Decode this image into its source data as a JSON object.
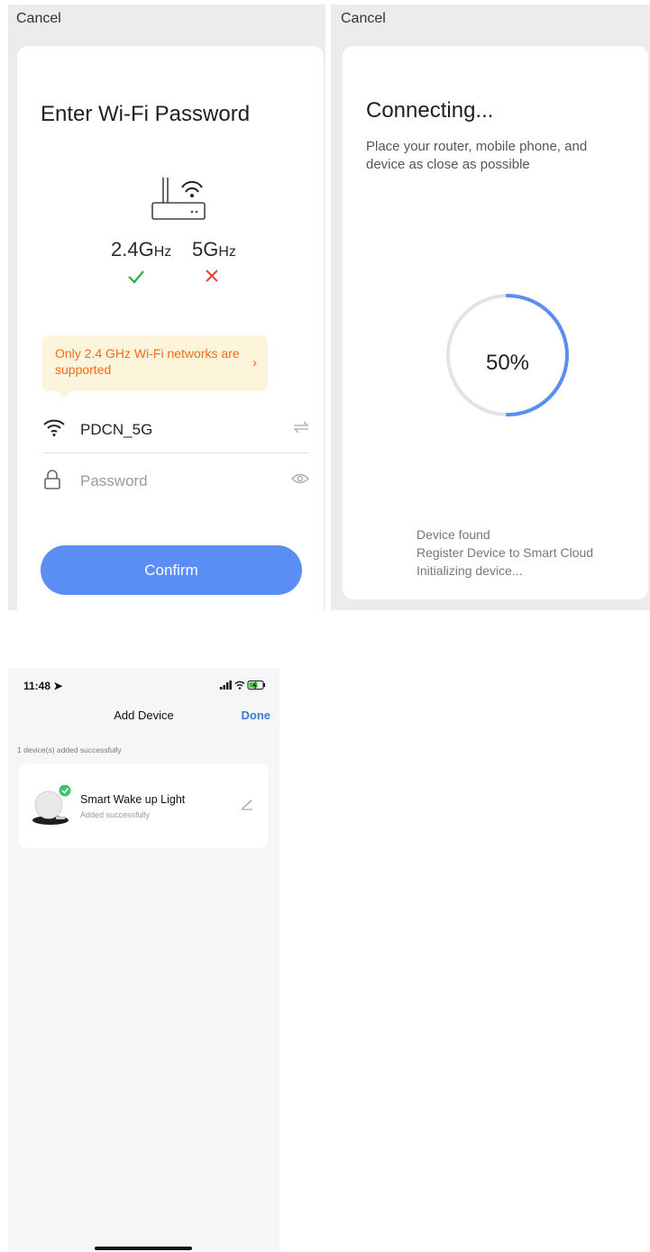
{
  "wifi_screen": {
    "cancel": "Cancel",
    "title": "Enter Wi-Fi Password",
    "band_24": "2.4G",
    "band_5": "5G",
    "band_unit": "Hz",
    "tip": "Only 2.4 GHz Wi-Fi networks are supported",
    "ssid": "PDCN_5G",
    "password_placeholder": "Password",
    "confirm": "Confirm",
    "colors": {
      "accent": "#5b8ef5",
      "ok": "#22b14c",
      "fail": "#f0453a",
      "tip_text": "#f06b1d"
    }
  },
  "connecting_screen": {
    "cancel": "Cancel",
    "title": "Connecting...",
    "subtitle": "Place your router, mobile phone, and device as close as possible",
    "progress_label": "50%",
    "progress": 0.5,
    "steps": [
      "Device found",
      "Register Device to Smart Cloud",
      "Initializing device..."
    ]
  },
  "add_device_screen": {
    "status_bar": {
      "time": "11:48"
    },
    "nav_title": "Add Device",
    "done": "Done",
    "added_count": "1 device(s) added successfully",
    "device": {
      "name": "Smart Wake up Light",
      "status": "Added successfully"
    }
  }
}
